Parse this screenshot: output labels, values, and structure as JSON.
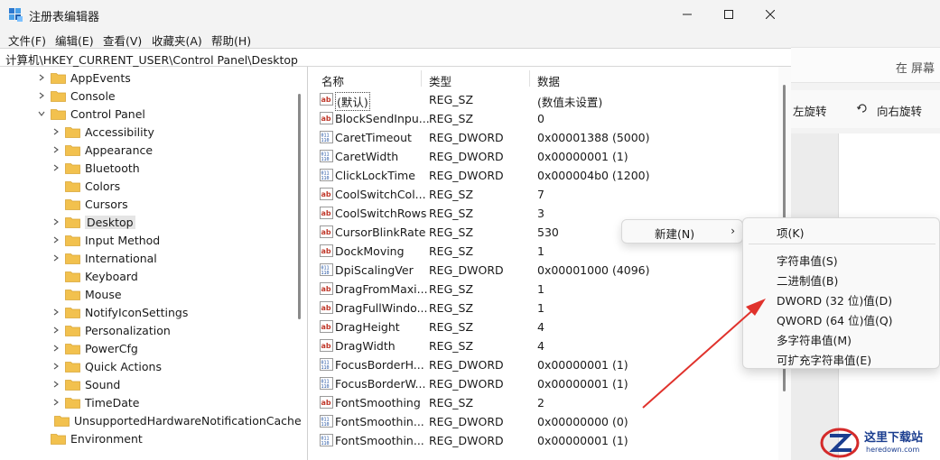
{
  "window": {
    "title": "注册表编辑器",
    "menu": [
      "文件(F)",
      "编辑(E)",
      "查看(V)",
      "收藏夹(A)",
      "帮助(H)"
    ],
    "address": "计算机\\HKEY_CURRENT_USER\\Control Panel\\Desktop"
  },
  "tree": {
    "items": [
      {
        "label": "AppEvents",
        "level": 1,
        "expanded": false
      },
      {
        "label": "Console",
        "level": 1,
        "expanded": false
      },
      {
        "label": "Control Panel",
        "level": 1,
        "expanded": true
      },
      {
        "label": "Accessibility",
        "level": 2,
        "expanded": false
      },
      {
        "label": "Appearance",
        "level": 2,
        "expanded": false
      },
      {
        "label": "Bluetooth",
        "level": 2,
        "expanded": false
      },
      {
        "label": "Colors",
        "level": 2,
        "leaf": true
      },
      {
        "label": "Cursors",
        "level": 2,
        "leaf": true
      },
      {
        "label": "Desktop",
        "level": 2,
        "expanded": false,
        "selected": true
      },
      {
        "label": "Input Method",
        "level": 2,
        "expanded": false
      },
      {
        "label": "International",
        "level": 2,
        "expanded": false
      },
      {
        "label": "Keyboard",
        "level": 2,
        "leaf": true
      },
      {
        "label": "Mouse",
        "level": 2,
        "leaf": true
      },
      {
        "label": "NotifyIconSettings",
        "level": 2,
        "expanded": false
      },
      {
        "label": "Personalization",
        "level": 2,
        "expanded": false
      },
      {
        "label": "PowerCfg",
        "level": 2,
        "expanded": false
      },
      {
        "label": "Quick Actions",
        "level": 2,
        "expanded": false
      },
      {
        "label": "Sound",
        "level": 2,
        "expanded": false
      },
      {
        "label": "TimeDate",
        "level": 2,
        "expanded": false
      },
      {
        "label": "UnsupportedHardwareNotificationCache",
        "level": 2,
        "leaf": true
      },
      {
        "label": "Environment",
        "level": 1,
        "leaf": true
      }
    ]
  },
  "list": {
    "columns": [
      "名称",
      "类型",
      "数据"
    ],
    "rows": [
      {
        "icon": "string",
        "name": "(默认)",
        "type": "REG_SZ",
        "data": "(数值未设置)"
      },
      {
        "icon": "string",
        "name": "BlockSendInpu...",
        "type": "REG_SZ",
        "data": "0"
      },
      {
        "icon": "binary",
        "name": "CaretTimeout",
        "type": "REG_DWORD",
        "data": "0x00001388 (5000)"
      },
      {
        "icon": "binary",
        "name": "CaretWidth",
        "type": "REG_DWORD",
        "data": "0x00000001 (1)"
      },
      {
        "icon": "binary",
        "name": "ClickLockTime",
        "type": "REG_DWORD",
        "data": "0x000004b0 (1200)"
      },
      {
        "icon": "string",
        "name": "CoolSwitchCol...",
        "type": "REG_SZ",
        "data": "7"
      },
      {
        "icon": "string",
        "name": "CoolSwitchRows",
        "type": "REG_SZ",
        "data": "3"
      },
      {
        "icon": "string",
        "name": "CursorBlinkRate",
        "type": "REG_SZ",
        "data": "530"
      },
      {
        "icon": "string",
        "name": "DockMoving",
        "type": "REG_SZ",
        "data": "1"
      },
      {
        "icon": "binary",
        "name": "DpiScalingVer",
        "type": "REG_DWORD",
        "data": "0x00001000 (4096)"
      },
      {
        "icon": "string",
        "name": "DragFromMaxi...",
        "type": "REG_SZ",
        "data": "1"
      },
      {
        "icon": "string",
        "name": "DragFullWindo...",
        "type": "REG_SZ",
        "data": "1"
      },
      {
        "icon": "string",
        "name": "DragHeight",
        "type": "REG_SZ",
        "data": "4"
      },
      {
        "icon": "string",
        "name": "DragWidth",
        "type": "REG_SZ",
        "data": "4"
      },
      {
        "icon": "binary",
        "name": "FocusBorderH...",
        "type": "REG_DWORD",
        "data": "0x00000001 (1)"
      },
      {
        "icon": "binary",
        "name": "FocusBorderW...",
        "type": "REG_DWORD",
        "data": "0x00000001 (1)"
      },
      {
        "icon": "string",
        "name": "FontSmoothing",
        "type": "REG_SZ",
        "data": "2"
      },
      {
        "icon": "binary",
        "name": "FontSmoothin...",
        "type": "REG_DWORD",
        "data": "0x00000000 (0)"
      },
      {
        "icon": "binary",
        "name": "FontSmoothin...",
        "type": "REG_DWORD",
        "data": "0x00000001 (1)"
      }
    ]
  },
  "context_menu": {
    "new_label": "新建(N)",
    "new_arrow": "›",
    "submenu": [
      "项(K)",
      "字符串值(S)",
      "二进制值(B)",
      "DWORD (32 位)值(D)",
      "QWORD (64 位)值(Q)",
      "多字符串值(M)",
      "可扩充字符串值(E)"
    ]
  },
  "background_app": {
    "search_text": "在 屏幕",
    "rotate_left": "左旋转",
    "rotate_right": "向右旋转"
  },
  "watermark": {
    "text": "这里下载站",
    "sub": "heredown.com"
  },
  "colors": {
    "arrow": "#e0322c",
    "folder": "#f2c14e",
    "selection": "#e5e5e5"
  }
}
